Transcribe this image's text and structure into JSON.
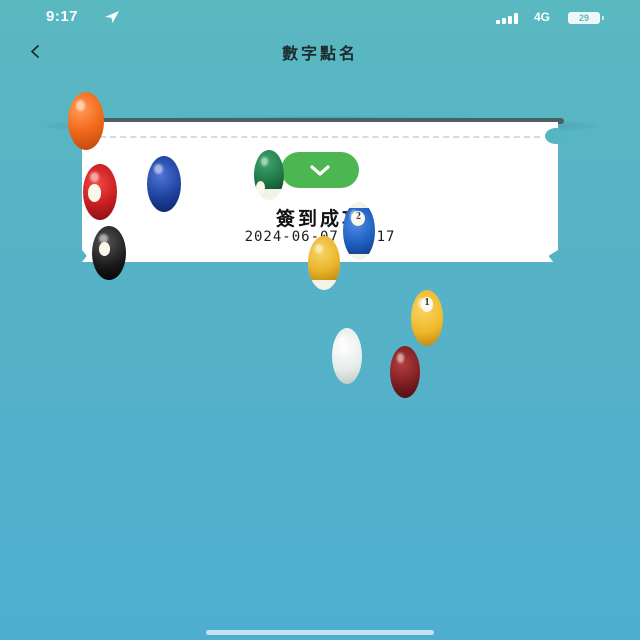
{
  "status_bar": {
    "time": "9:17",
    "network": "4G",
    "battery": "29"
  },
  "header": {
    "back_label": "<",
    "title": "數字點名"
  },
  "ticket": {
    "success_message": "簽到成功",
    "timestamp": "2024-06-07 09:17"
  },
  "billiard_balls": [
    {
      "name": "orange-ball",
      "color": "#f26b1c",
      "number": ""
    },
    {
      "name": "red-ball",
      "color": "#c81e22",
      "number": ""
    },
    {
      "name": "black-ball",
      "color": "#1a1a1a",
      "number": ""
    },
    {
      "name": "blue-ball",
      "color": "#1c3f9a",
      "number": ""
    },
    {
      "name": "green-striped-ball",
      "color": "#1e7a47",
      "number": ""
    },
    {
      "name": "yellow-striped-ball",
      "color": "#e9b52a",
      "number": ""
    },
    {
      "name": "blue-striped-ball",
      "color": "#1e5fbf",
      "number": "2"
    },
    {
      "name": "yellow-ball",
      "color": "#efb728",
      "number": "1"
    },
    {
      "name": "white-cue-ball",
      "color": "#eef2ef",
      "number": ""
    },
    {
      "name": "maroon-ball",
      "color": "#7a1c1f",
      "number": ""
    }
  ],
  "colors": {
    "background_top": "#5ab8c1",
    "background_bottom": "#4faed0",
    "success_green": "#4cb751"
  }
}
